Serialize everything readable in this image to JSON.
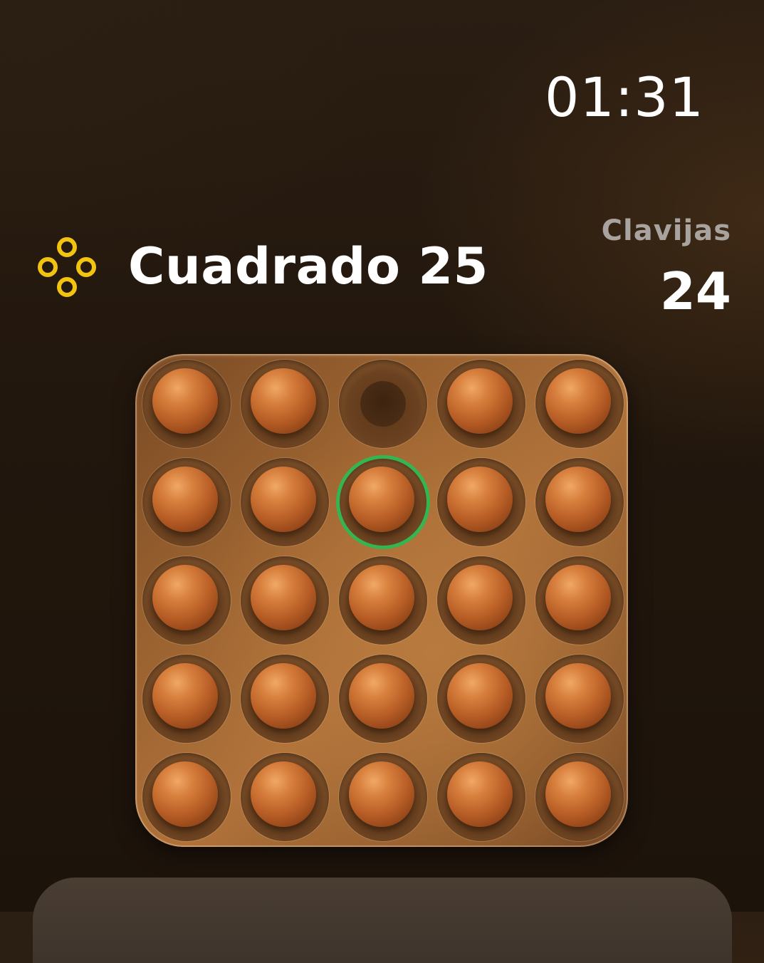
{
  "status": {
    "time": "01:31"
  },
  "header": {
    "game_icon": "peg-cluster-icon",
    "title": "Cuadrado 25",
    "pegs_label": "Clavijas",
    "pegs_count": "24"
  },
  "board": {
    "rows": 5,
    "cols": 5,
    "cells": [
      [
        "peg",
        "peg",
        "empty",
        "peg",
        "peg"
      ],
      [
        "peg",
        "peg",
        "peg",
        "peg",
        "peg"
      ],
      [
        "peg",
        "peg",
        "peg",
        "peg",
        "peg"
      ],
      [
        "peg",
        "peg",
        "peg",
        "peg",
        "peg"
      ],
      [
        "peg",
        "peg",
        "peg",
        "peg",
        "peg"
      ]
    ],
    "selected": {
      "row": 1,
      "col": 2
    },
    "selected_color": "#35b54f"
  },
  "colors": {
    "accent_icon": "#f2c40f",
    "selection": "#35b54f"
  }
}
